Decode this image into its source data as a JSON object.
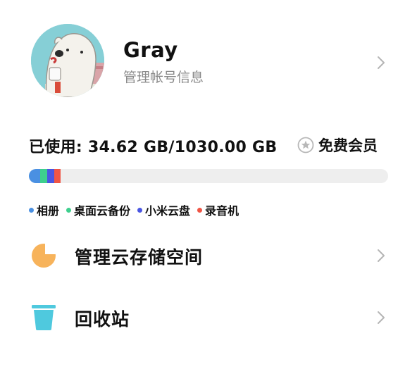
{
  "profile": {
    "username": "Gray",
    "subtitle": "管理帐号信息"
  },
  "storage": {
    "usage_text": "已使用: 34.62 GB/1030.00 GB",
    "member_label": "免费会员",
    "segments": [
      {
        "name": "相册",
        "color": "#4a90e2",
        "fraction": 0.031
      },
      {
        "name": "桌面云备份",
        "color": "#3ecf8e",
        "fraction": 0.02
      },
      {
        "name": "小米云盘",
        "color": "#4a56e2",
        "fraction": 0.02
      },
      {
        "name": "录音机",
        "color": "#f05545",
        "fraction": 0.017
      }
    ],
    "legend": [
      {
        "label": "相册",
        "color": "#4a90e2"
      },
      {
        "label": "桌面云备份",
        "color": "#3ecf8e"
      },
      {
        "label": "小米云盘",
        "color": "#4a56e2"
      },
      {
        "label": "录音机",
        "color": "#f05545"
      }
    ]
  },
  "menu": {
    "manage_storage": {
      "label": "管理云存储空间",
      "icon": "pie-chart-icon",
      "color": "#f7b35b"
    },
    "recycle_bin": {
      "label": "回收站",
      "icon": "trash-icon",
      "color": "#4fc9de"
    }
  }
}
